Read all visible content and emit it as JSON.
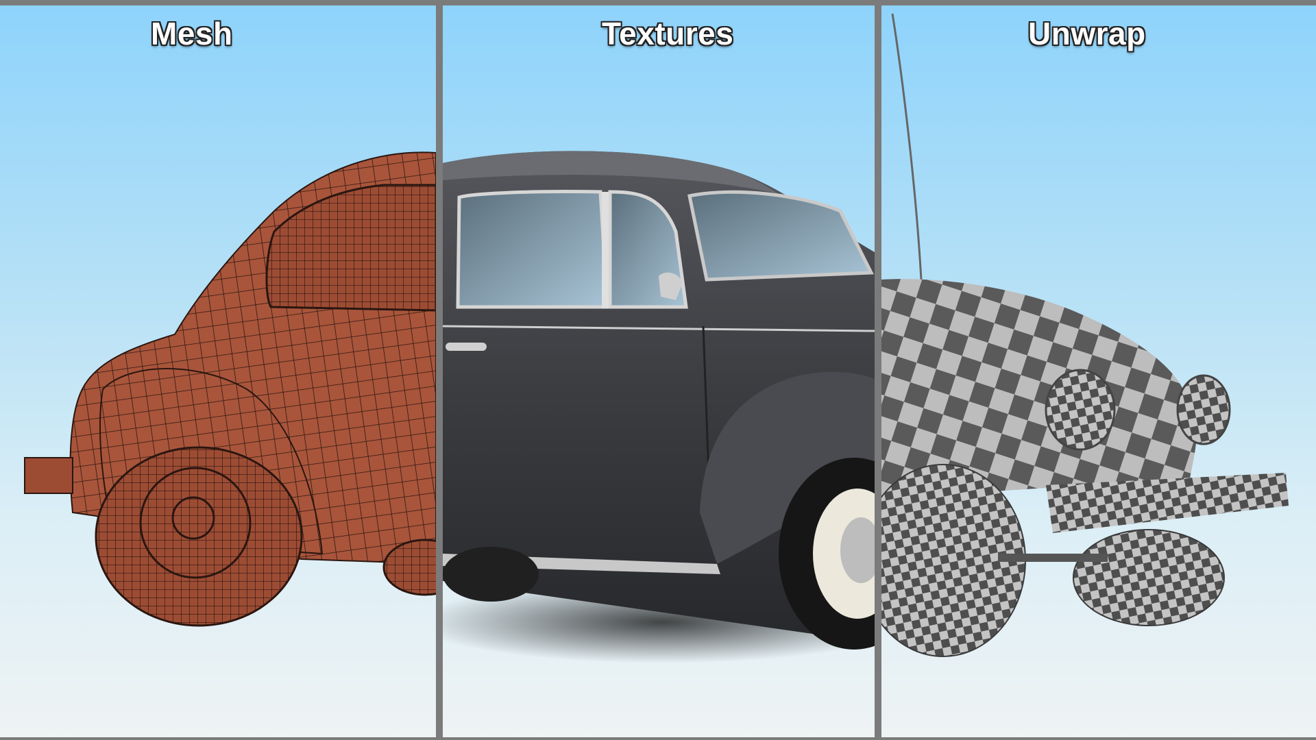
{
  "panels": [
    {
      "title": "Mesh"
    },
    {
      "title": "Textures"
    },
    {
      "title": "Unwrap"
    }
  ],
  "colors": {
    "divider": "#7b7b7b",
    "sky_top": "#8ed3fb",
    "sky_bottom": "#eef3f4",
    "mesh_body": "#a9553b",
    "mesh_wire": "#2a1610",
    "paint_body": "#3c3d41",
    "checker_light": "#bdbdbd",
    "checker_dark": "#5a5a5a"
  },
  "icons": [
    "mesh-car-render",
    "textured-car-render",
    "checker-car-render"
  ]
}
